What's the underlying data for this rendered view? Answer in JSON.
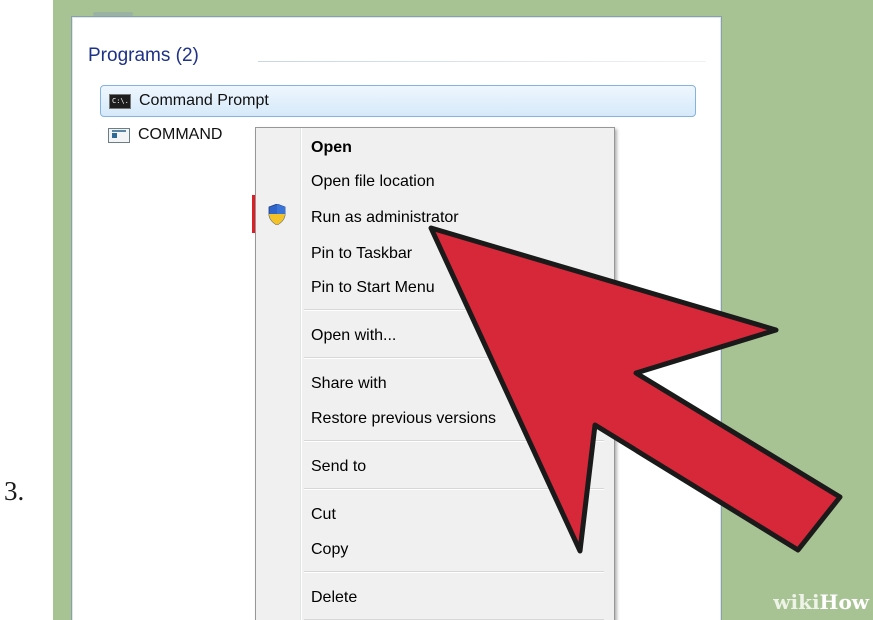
{
  "step_number": "3.",
  "panel": {
    "group_header": "Programs (2)",
    "results": [
      {
        "label": "Command Prompt",
        "icon": "cmd-icon",
        "icon_text": "C:\\."
      },
      {
        "label": "COMMAND",
        "icon": "prompt-icon"
      }
    ]
  },
  "context_menu": {
    "open": "Open",
    "open_file_location": "Open file location",
    "run_as_admin": "Run as administrator",
    "pin_taskbar": "Pin to Taskbar",
    "pin_start": "Pin to Start Menu",
    "open_with": "Open with...",
    "share_with": "Share with",
    "restore_prev": "Restore previous versions",
    "send_to": "Send to",
    "cut": "Cut",
    "copy": "Copy",
    "delete": "Delete"
  },
  "watermark": {
    "wiki": "wiki",
    "how": "How"
  },
  "colors": {
    "frame": "#a7c393",
    "highlight_border": "#de1f26",
    "arrow_fill": "#d7283a",
    "arrow_stroke": "#1a1a1a",
    "header_text": "#1e3287"
  }
}
